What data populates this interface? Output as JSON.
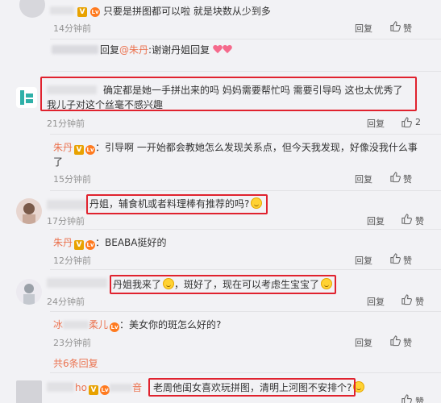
{
  "comments": [
    {
      "id": "c1",
      "text": "只要是拼图都可以啦 就是块数从少到多",
      "time": "14分钟前",
      "reply": "回复",
      "like": "赞"
    },
    {
      "id": "c2",
      "reply_label": "回复",
      "reply_to": "@朱丹",
      "text": ":谢谢丹姐回复",
      "time": "",
      "reply": "",
      "like": ""
    },
    {
      "id": "c3",
      "text": "确定都是她一手拼出来的吗 妈妈需要帮忙吗 需要引导吗 这也太优秀了 我儿子对这个丝毫不感兴趣",
      "time": "21分钟前",
      "reply": "回复",
      "like": "2"
    },
    {
      "id": "c4",
      "name": "朱丹",
      "text": "引导啊 一开始都会教她怎么发现关系点，但今天我发现，好像没我什么事了",
      "time": "15分钟前",
      "reply": "回复",
      "like": "赞"
    },
    {
      "id": "c5",
      "text": "丹姐，辅食机或者料理棒有推荐的吗?",
      "time": "17分钟前",
      "reply": "回复",
      "like": "赞"
    },
    {
      "id": "c6",
      "name": "朱丹",
      "text": "BEABA挺好的",
      "time": "12分钟前",
      "reply": "回复",
      "like": "赞"
    },
    {
      "id": "c7",
      "text_a": "丹姐我来了",
      "text_b": "，斑好了，现在可以考虑生宝宝了",
      "time": "24分钟前",
      "reply": "回复",
      "like": "赞"
    },
    {
      "id": "c8",
      "name_a": "冰",
      "name_b": "柔儿",
      "text": "美女你的斑怎么好的?",
      "time": "23分钟前",
      "reply": "回复",
      "like": "赞"
    },
    {
      "id": "c9",
      "more": "共6条回复"
    },
    {
      "id": "c10",
      "name_a": "ho",
      "name_b": "音",
      "text": "老周他闺女喜欢玩拼图，清明上河图不安排个?",
      "like": "赞"
    }
  ]
}
